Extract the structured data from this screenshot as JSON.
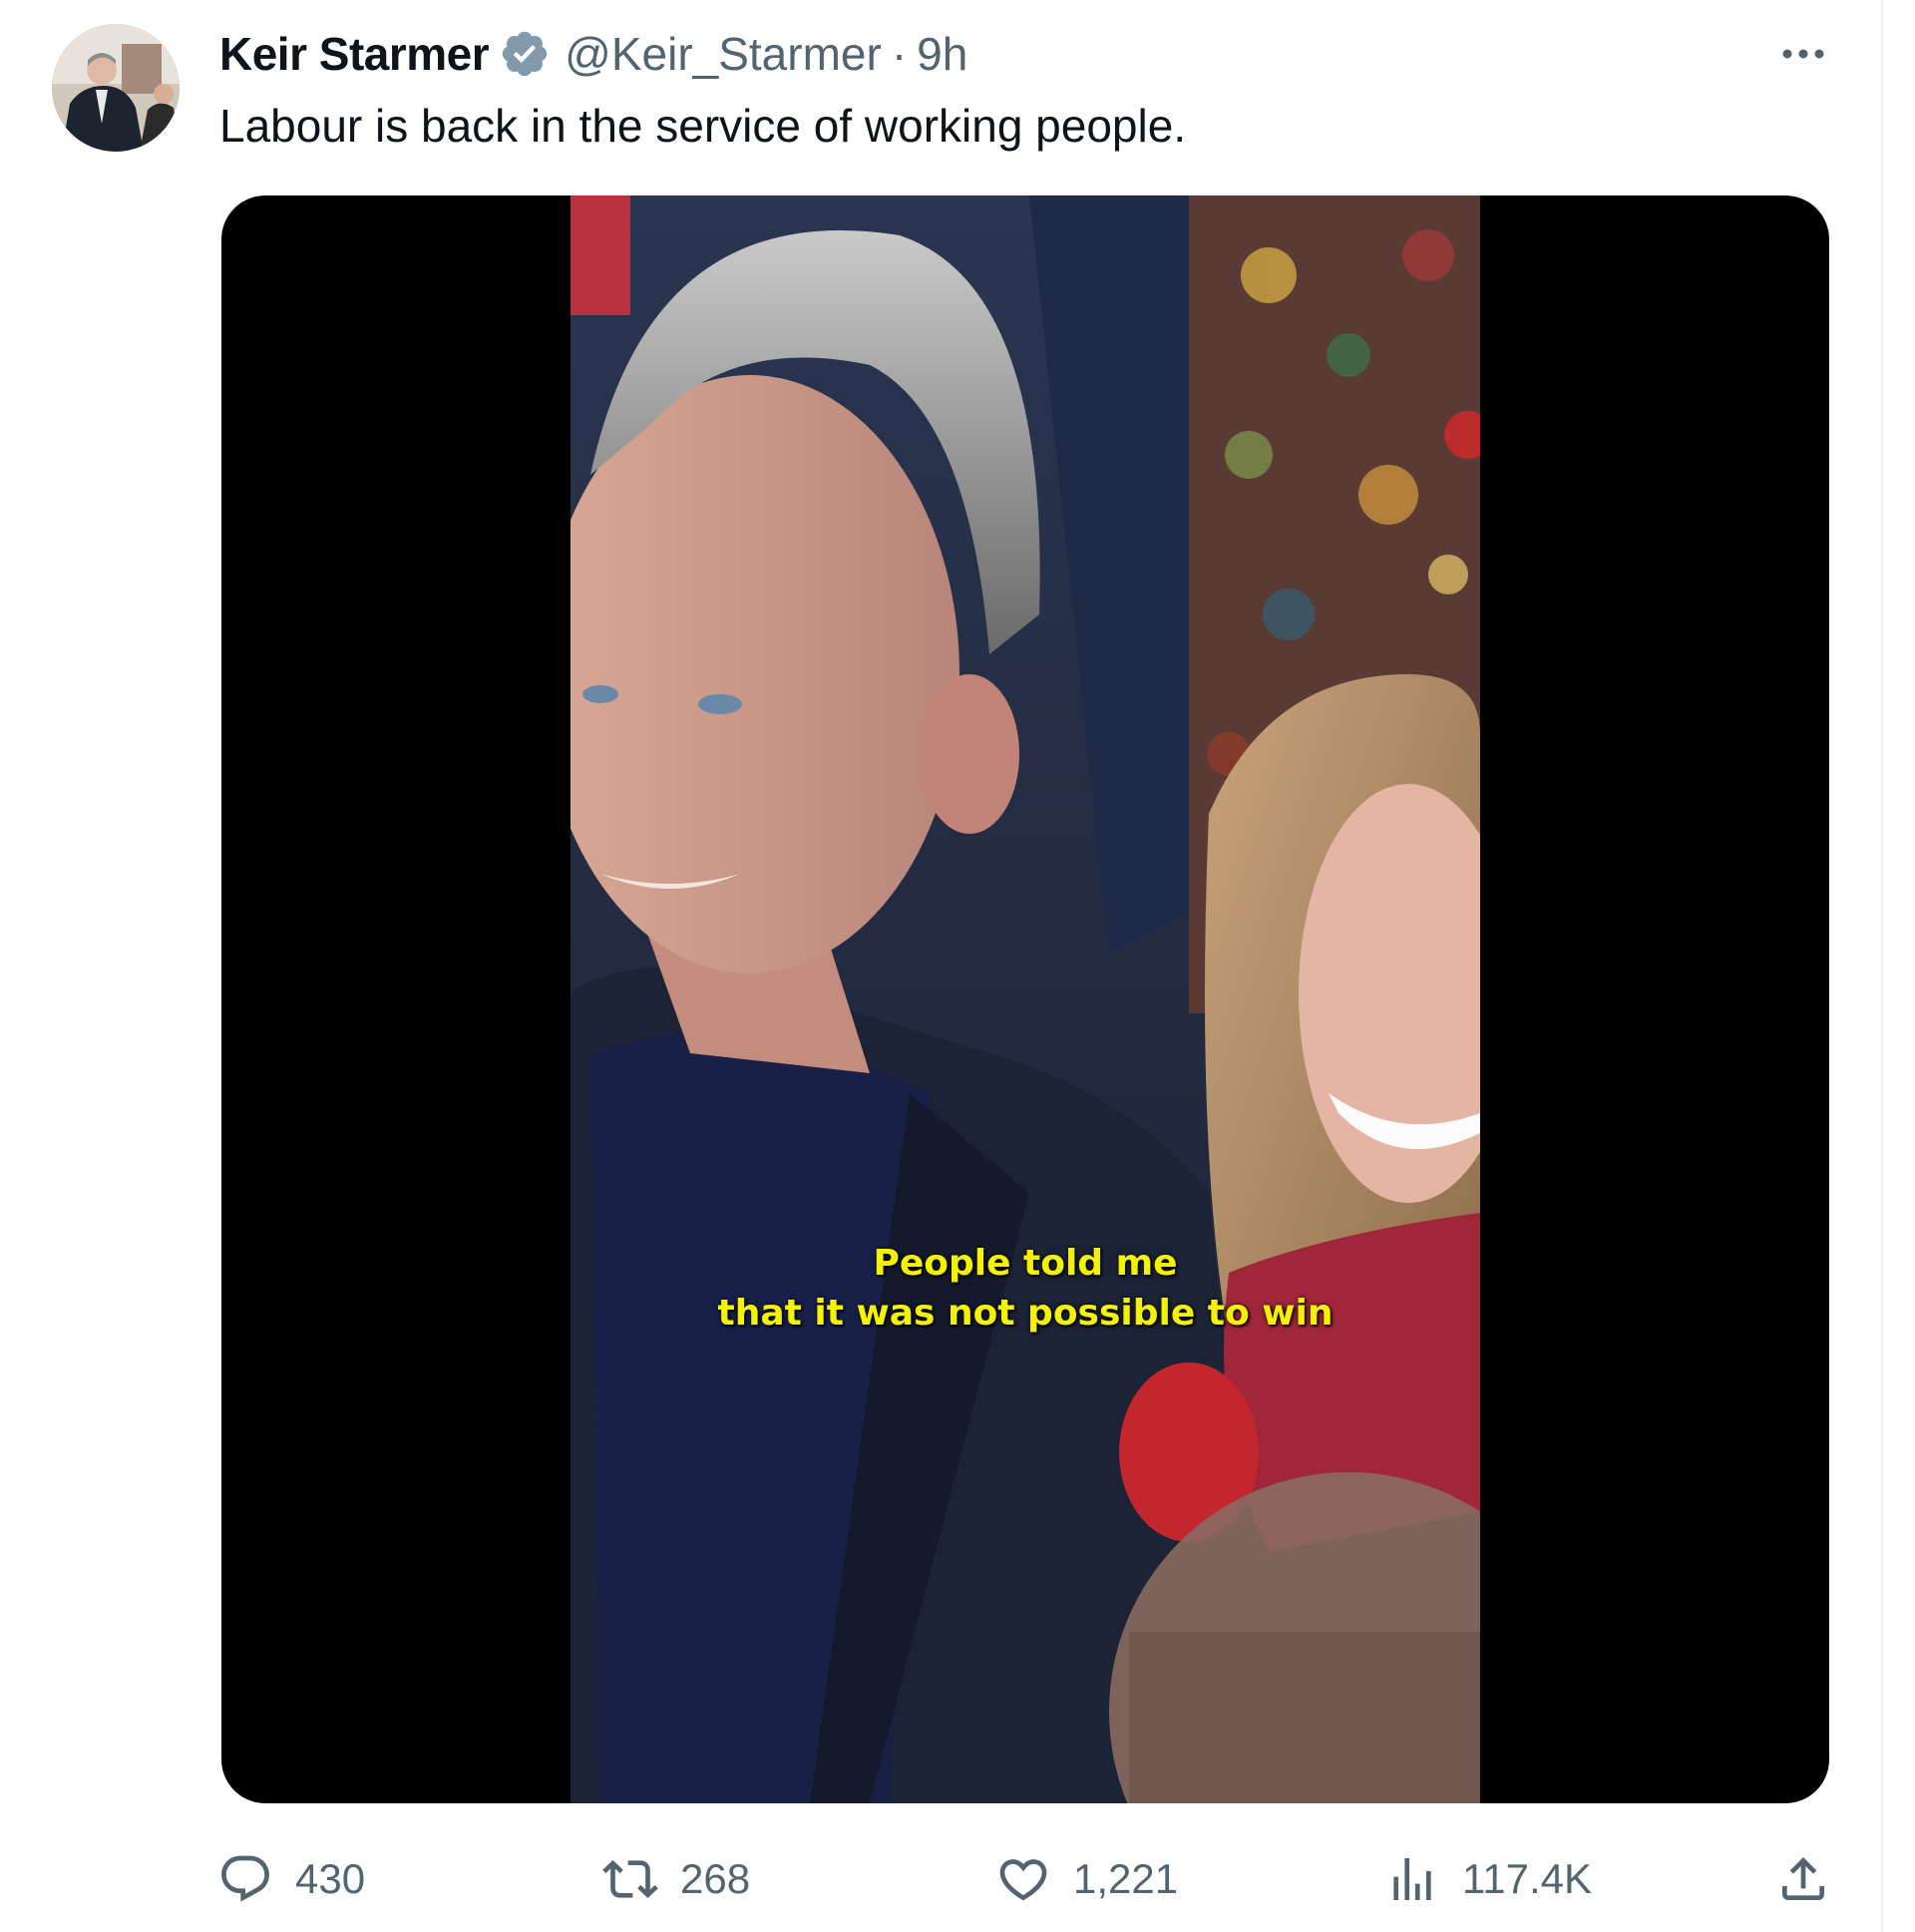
{
  "tweet": {
    "author": {
      "display_name": "Keir Starmer",
      "handle": "@Keir_Starmer",
      "verified_icon": "verified-badge-icon"
    },
    "separator": "·",
    "time": "9h",
    "text": "Labour is back in the service of working people.",
    "media": {
      "caption_line1": "People told me",
      "caption_line2": "that it was not possible to win"
    },
    "stats": {
      "replies": "430",
      "reposts": "268",
      "likes": "1,221",
      "views": "117.4K"
    }
  },
  "colors": {
    "text_primary": "#0f1419",
    "text_secondary": "#536471",
    "verified_grey": "#829aab",
    "caption_yellow": "#f5f200"
  }
}
